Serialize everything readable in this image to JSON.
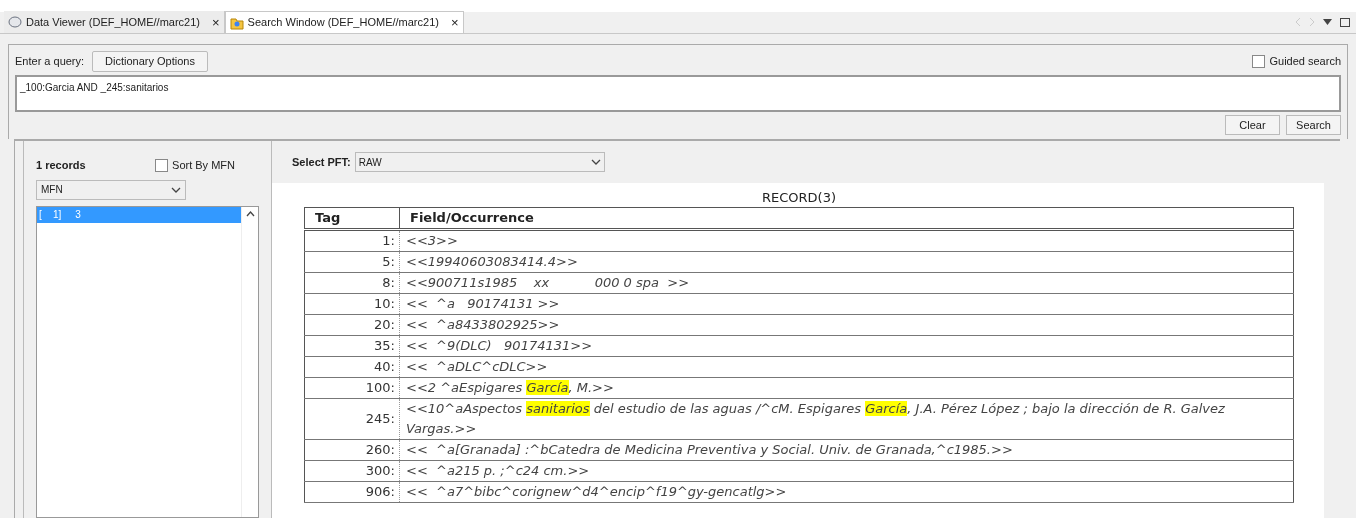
{
  "tabs": [
    {
      "label": "Data Viewer (DEF_HOME//marc21)",
      "selected": false,
      "kind": "viewer",
      "close": "×"
    },
    {
      "label": "Search Window (DEF_HOME//marc21)",
      "selected": true,
      "kind": "search",
      "close": "×"
    }
  ],
  "query": {
    "label": "Enter a query:",
    "dictionary_button": "Dictionary Options",
    "guided_search": {
      "label": "Guided search",
      "checked": false
    },
    "value": "_100:Garcia AND _245:sanitarios",
    "buttons": [
      "Clear",
      "Search"
    ]
  },
  "results": {
    "count": "1 records",
    "sort_by_mfn": {
      "label": "Sort By MFN",
      "checked": false
    },
    "sort_select": "MFN",
    "items": [
      {
        "index": "[    1]",
        "mfn": "3",
        "selected": true
      }
    ]
  },
  "record": {
    "pft_label": "Select PFT:",
    "pft_value": "RAW",
    "title": "RECORD(3)",
    "columns": [
      "Tag",
      "Field/Occurrence"
    ],
    "rows": [
      {
        "tag": "1:",
        "field": [
          {
            "text": "<<3>>",
            "highlighted": false
          }
        ]
      },
      {
        "tag": "5:",
        "field": [
          {
            "text": "<<19940603083414.4>>",
            "highlighted": false
          }
        ]
      },
      {
        "tag": "8:",
        "field": [
          {
            "text": "<<900711s1985    xx           000 0 spa  >>",
            "highlighted": false
          }
        ]
      },
      {
        "tag": "10:",
        "field": [
          {
            "text": "<<  ^a   90174131 >>",
            "highlighted": false
          }
        ]
      },
      {
        "tag": "20:",
        "field": [
          {
            "text": "<<  ^a8433802925>>",
            "highlighted": false
          }
        ]
      },
      {
        "tag": "35:",
        "field": [
          {
            "text": "<<  ^9(DLC)   90174131>>",
            "highlighted": false
          }
        ]
      },
      {
        "tag": "40:",
        "field": [
          {
            "text": "<<  ^aDLC^cDLC>>",
            "highlighted": false
          }
        ]
      },
      {
        "tag": "100:",
        "field": [
          {
            "text": "<<2 ^aEspigares ",
            "highlighted": false
          },
          {
            "text": "García",
            "highlighted": true
          },
          {
            "text": ", M.>>",
            "highlighted": false
          }
        ]
      },
      {
        "tag": "245:",
        "field": [
          {
            "text": "<<10^aAspectos ",
            "highlighted": false
          },
          {
            "text": "sanitarios",
            "highlighted": true
          },
          {
            "text": " del estudio de las aguas /^cM. Espigares ",
            "highlighted": false
          },
          {
            "text": "García",
            "highlighted": true
          },
          {
            "text": ", J.A. Pérez López ; bajo la dirección de R. Galvez Vargas.>>",
            "highlighted": false
          }
        ]
      },
      {
        "tag": "260:",
        "field": [
          {
            "text": "<<  ^a[Granada] :^bCatedra de Medicina Preventiva y Social. Univ. de Granada,^c1985.>>",
            "highlighted": false
          }
        ]
      },
      {
        "tag": "300:",
        "field": [
          {
            "text": "<<  ^a215 p. ;^c24 cm.>>",
            "highlighted": false
          }
        ]
      },
      {
        "tag": "906:",
        "field": [
          {
            "text": "<<  ^a7^bibc^corignew^d4^encip^f19^gy-gencatlg>>",
            "highlighted": false
          }
        ]
      }
    ]
  }
}
